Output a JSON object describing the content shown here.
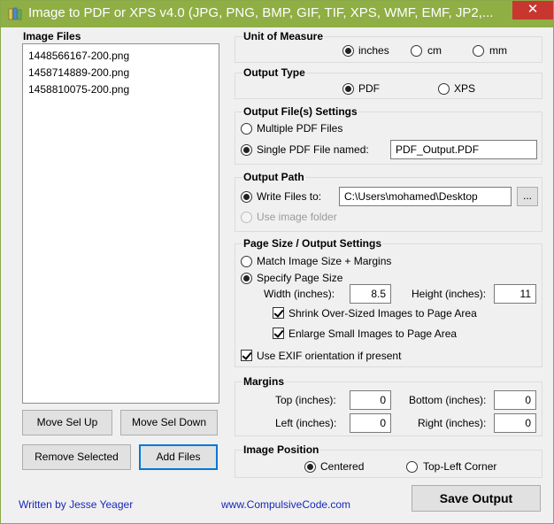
{
  "window": {
    "title": "Image to PDF or XPS  v4.0   (JPG, PNG, BMP, GIF, TIF, XPS, WMF, EMF, JP2,...",
    "close_glyph": "✕"
  },
  "image_files": {
    "label": "Image Files",
    "items": [
      "1448566167-200.png",
      "1458714889-200.png",
      "1458810075-200.png"
    ]
  },
  "buttons": {
    "move_up": "Move Sel Up",
    "move_down": "Move Sel Down",
    "remove": "Remove Selected",
    "add": "Add Files",
    "save": "Save Output",
    "browse": "..."
  },
  "footer": {
    "author": "Written by Jesse Yeager",
    "website": "www.CompulsiveCode.com"
  },
  "unit": {
    "title": "Unit of Measure",
    "options": [
      "inches",
      "cm",
      "mm"
    ],
    "selected": "inches"
  },
  "output_type": {
    "title": "Output Type",
    "options": [
      "PDF",
      "XPS"
    ],
    "selected": "PDF"
  },
  "output_files": {
    "title": "Output File(s) Settings",
    "multiple_label": "Multiple PDF Files",
    "single_label": "Single PDF File named:",
    "single_selected": true,
    "filename": "PDF_Output.PDF"
  },
  "output_path": {
    "title": "Output Path",
    "write_label": "Write Files to:",
    "path": "C:\\Users\\mohamed\\Desktop",
    "use_folder_label": "Use image folder"
  },
  "page_size": {
    "title": "Page Size / Output Settings",
    "match_label": "Match Image Size + Margins",
    "specify_label": "Specify Page Size",
    "selected": "specify",
    "width_label": "Width (inches):",
    "width": "8.5",
    "height_label": "Height (inches):",
    "height": "11",
    "shrink_label": "Shrink Over-Sized Images to Page Area",
    "shrink_checked": true,
    "enlarge_label": "Enlarge Small Images to Page Area",
    "enlarge_checked": true,
    "exif_label": "Use EXIF orientation if present",
    "exif_checked": true
  },
  "margins": {
    "title": "Margins",
    "top_label": "Top (inches):",
    "top": "0",
    "bottom_label": "Bottom (inches):",
    "bottom": "0",
    "left_label": "Left (inches):",
    "left": "0",
    "right_label": "Right (inches):",
    "right": "0"
  },
  "image_position": {
    "title": "Image Position",
    "centered_label": "Centered",
    "topleft_label": "Top-Left Corner",
    "selected": "Centered"
  },
  "colors": {
    "titlebar": "#8fae44",
    "close": "#c7372f",
    "link": "#1a27b8",
    "default_button_border": "#0078d7"
  }
}
